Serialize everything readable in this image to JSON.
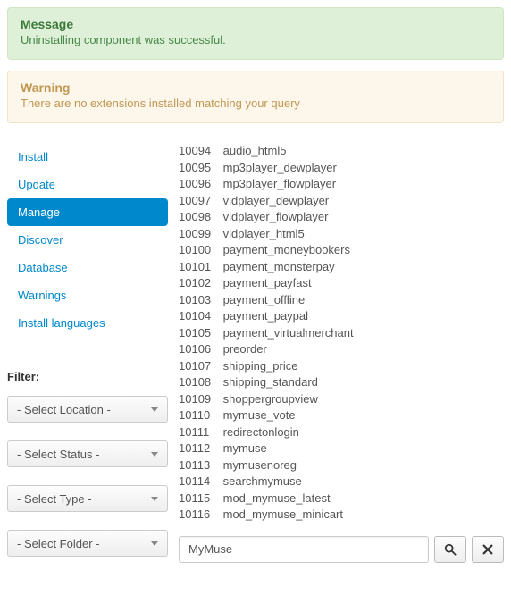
{
  "alerts": {
    "success": {
      "title": "Message",
      "text": "Uninstalling component was successful."
    },
    "warning": {
      "title": "Warning",
      "text": "There are no extensions installed matching your query"
    }
  },
  "sidebar": {
    "items": [
      {
        "label": "Install"
      },
      {
        "label": "Update"
      },
      {
        "label": "Manage"
      },
      {
        "label": "Discover"
      },
      {
        "label": "Database"
      },
      {
        "label": "Warnings"
      },
      {
        "label": "Install languages"
      }
    ]
  },
  "filter": {
    "label": "Filter:",
    "location": "- Select Location -",
    "status": "- Select Status -",
    "type": "- Select Type -",
    "folder": "- Select Folder -"
  },
  "list": [
    {
      "id": "10094",
      "name": "audio_html5"
    },
    {
      "id": "10095",
      "name": "mp3player_dewplayer"
    },
    {
      "id": "10096",
      "name": "mp3player_flowplayer"
    },
    {
      "id": "10097",
      "name": "vidplayer_dewplayer"
    },
    {
      "id": "10098",
      "name": "vidplayer_flowplayer"
    },
    {
      "id": "10099",
      "name": "vidplayer_html5"
    },
    {
      "id": "10100",
      "name": "payment_moneybookers"
    },
    {
      "id": "10101",
      "name": "payment_monsterpay"
    },
    {
      "id": "10102",
      "name": "payment_payfast"
    },
    {
      "id": "10103",
      "name": "payment_offline"
    },
    {
      "id": "10104",
      "name": "payment_paypal"
    },
    {
      "id": "10105",
      "name": "payment_virtualmerchant"
    },
    {
      "id": "10106",
      "name": "preorder"
    },
    {
      "id": "10107",
      "name": "shipping_price"
    },
    {
      "id": "10108",
      "name": "shipping_standard"
    },
    {
      "id": "10109",
      "name": "shoppergroupview"
    },
    {
      "id": "10110",
      "name": "mymuse_vote"
    },
    {
      "id": "10111",
      "name": "redirectonlogin"
    },
    {
      "id": "10112",
      "name": "mymuse"
    },
    {
      "id": "10113",
      "name": "mymusenoreg"
    },
    {
      "id": "10114",
      "name": "searchmymuse"
    },
    {
      "id": "10115",
      "name": "mod_mymuse_latest"
    },
    {
      "id": "10116",
      "name": "mod_mymuse_minicart"
    }
  ],
  "search": {
    "value": "MyMuse"
  }
}
